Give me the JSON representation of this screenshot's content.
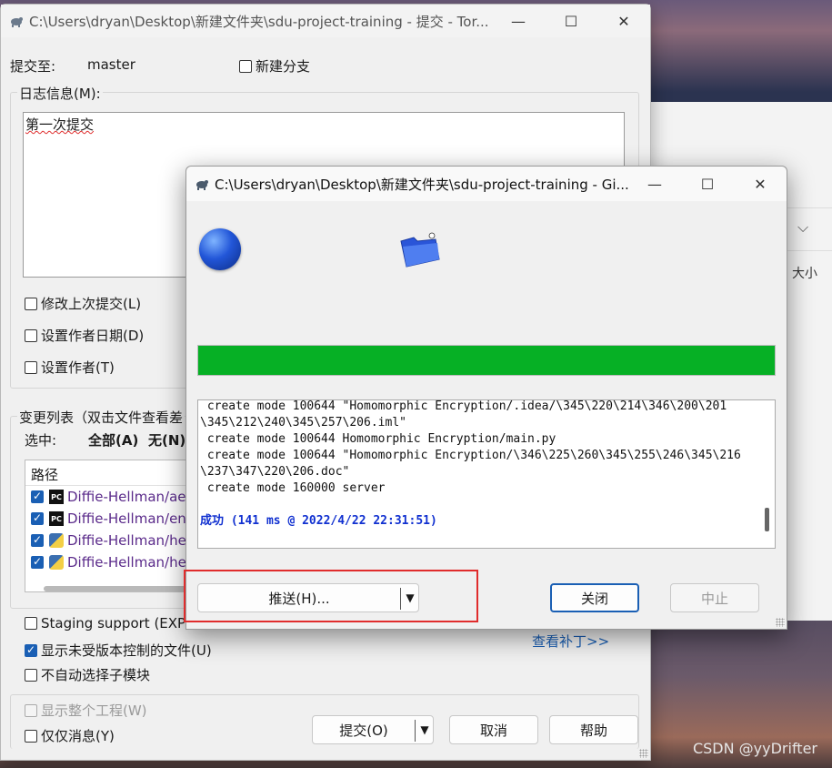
{
  "commit_window": {
    "title": "C:\\Users\\dryan\\Desktop\\新建文件夹\\sdu-project-training - 提交 - Tor...",
    "commit_to_label": "提交至:",
    "branch": "master",
    "new_branch_label": "新建分支",
    "message_group_label": "日志信息(M):",
    "message_text": "第一次提交",
    "options": [
      {
        "label": "修改上次提交(L)",
        "checked": false
      },
      {
        "label": "设置作者日期(D)",
        "checked": false
      },
      {
        "label": "设置作者(T)",
        "checked": false
      }
    ],
    "changes_label": "变更列表（双击文件查看差",
    "select_label": "选中:",
    "select_all": "全部(A)",
    "select_none": "无(N)",
    "file_list": {
      "header": "路径",
      "rows": [
        {
          "name": "Diffie-Hellman/aes-",
          "icon": "pycharm-icon",
          "checked": true
        },
        {
          "name": "Diffie-Hellman/enc",
          "icon": "pycharm-icon",
          "checked": true
        },
        {
          "name": "Diffie-Hellman/hell",
          "icon": "python-file-icon",
          "checked": true
        },
        {
          "name": "Diffie-Hellman/hell",
          "icon": "python-file-icon",
          "checked": true
        }
      ]
    },
    "staging_label": "Staging support (EXPER",
    "show_unversioned_label": "显示未受版本控制的文件(U)",
    "no_auto_submodules_label": "不自动选择子模块",
    "show_whole_project_label": "显示整个工程(W)",
    "message_only_label": "仅仅消息(Y)",
    "view_patch_link": "查看补丁>>",
    "commit_button": "提交(O)",
    "cancel_button": "取消",
    "help_button": "帮助"
  },
  "progress_dialog": {
    "title": "C:\\Users\\dryan\\Desktop\\新建文件夹\\sdu-project-training - Gi...",
    "progress_fraction": 1.0,
    "progress_color": "#06b025",
    "log_lines": [
      " create mode 100644 \"Homomorphic Encryption/.idea/\\345\\220\\214\\346\\200\\201",
      "\\345\\212\\240\\345\\257\\206.iml\"",
      " create mode 100644 Homomorphic Encryption/main.py",
      " create mode 100644 \"Homomorphic Encryption/\\346\\225\\260\\345\\255\\246\\345\\216",
      "\\237\\347\\220\\206.doc\"",
      " create mode 160000 server",
      ""
    ],
    "success_line": "成功 (141 ms @ 2022/4/22 22:31:51)",
    "push_button": "推送(H)...",
    "close_button": "关闭",
    "abort_button": "中止"
  },
  "background_window": {
    "size_label": "大小"
  },
  "watermark": "CSDN @yyDrifter",
  "colors": {
    "accent": "#1a5fb4",
    "highlight_box": "#e02c2c",
    "success_text": "#1030d0"
  }
}
